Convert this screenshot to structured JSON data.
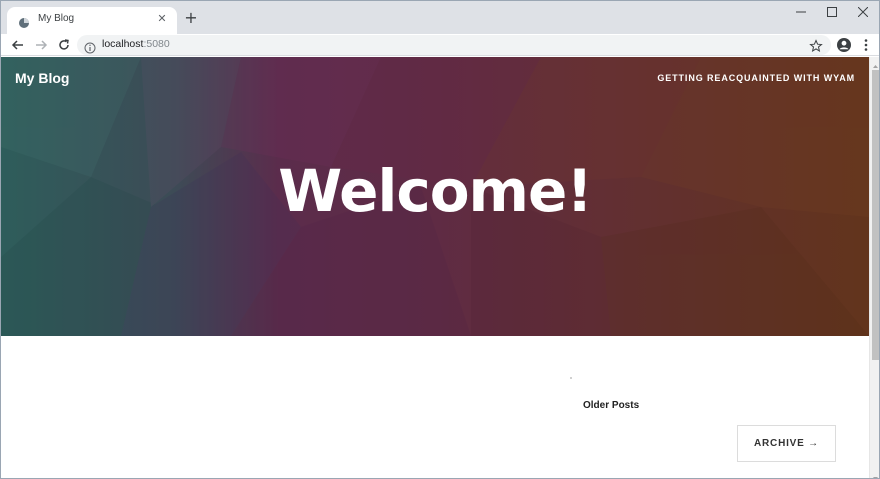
{
  "browser": {
    "tab_title": "My Blog",
    "tab_close": "✕",
    "new_tab": "+",
    "url_host": "localhost",
    "url_port": ":5080"
  },
  "site": {
    "brand": "My Blog",
    "nav_link": "GETTING REACQUAINTED WITH WYAM",
    "hero_title": "Welcome!",
    "older_posts_label": "Older Posts",
    "archive_button": "ARCHIVE →"
  },
  "colors": {
    "hero_left": "#2e5d5b",
    "hero_middle": "#5e2a46",
    "hero_right": "#62341f",
    "tabstrip": "#dee1e6"
  },
  "icons": [
    "favicon-icon",
    "close-icon",
    "plus-icon",
    "minimize-icon",
    "maximize-icon",
    "window-close-icon",
    "back-arrow-icon",
    "forward-arrow-icon",
    "reload-icon",
    "info-icon",
    "star-icon",
    "profile-icon",
    "menu-dots-icon"
  ]
}
